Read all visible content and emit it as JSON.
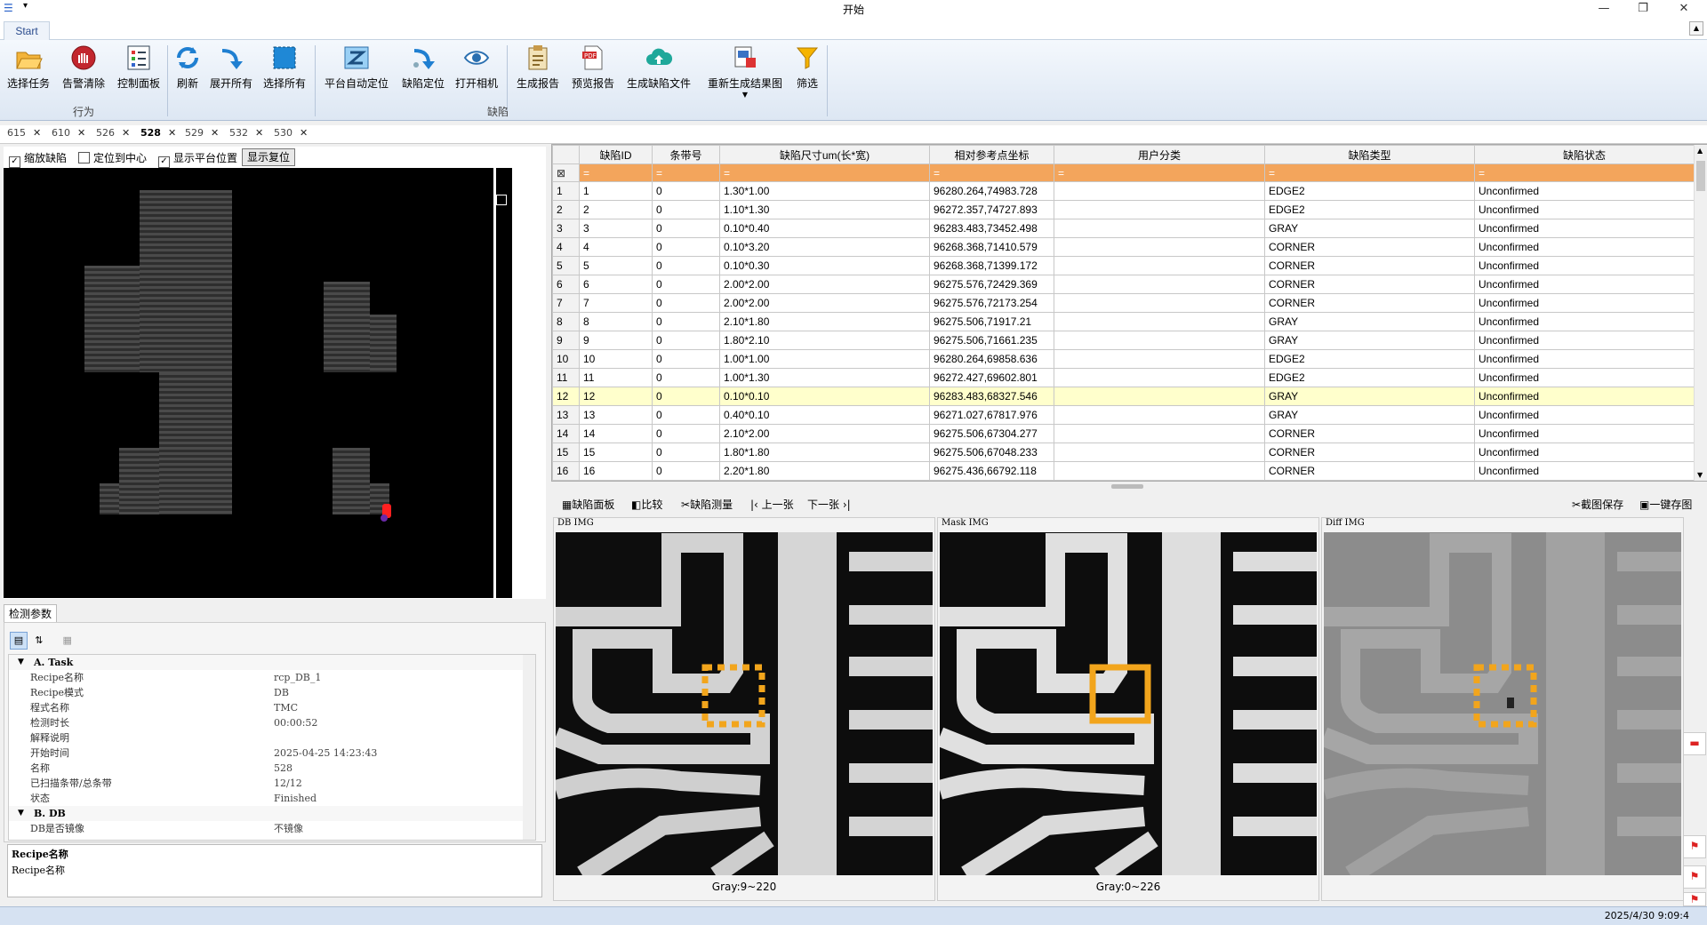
{
  "window": {
    "title": "开始",
    "tab": "Start"
  },
  "ribbon": {
    "buttons": [
      {
        "label": "选择任务",
        "icon": "folder-open-icon"
      },
      {
        "label": "告警清除",
        "icon": "alarm-clear-icon"
      },
      {
        "label": "控制面板",
        "icon": "control-panel-icon"
      },
      {
        "label": "刷新",
        "icon": "refresh-icon"
      },
      {
        "label": "展开所有",
        "icon": "expand-all-icon"
      },
      {
        "label": "选择所有",
        "icon": "select-all-icon"
      },
      {
        "label": "平台自动定位",
        "icon": "auto-locate-icon"
      },
      {
        "label": "缺陷定位",
        "icon": "defect-locate-icon"
      },
      {
        "label": "打开相机",
        "icon": "eye-icon"
      },
      {
        "label": "生成报告",
        "icon": "report-icon"
      },
      {
        "label": "预览报告",
        "icon": "pdf-icon"
      },
      {
        "label": "生成缺陷文件",
        "icon": "cloud-upload-icon"
      },
      {
        "label": "重新生成结果图",
        "icon": "regenerate-icon"
      },
      {
        "label": "筛选",
        "icon": "filter-icon"
      }
    ],
    "groups": {
      "behavior": "行为",
      "defect": "缺陷"
    }
  },
  "doc_tabs": [
    "615",
    "610",
    "526",
    "528",
    "529",
    "532",
    "530"
  ],
  "options": {
    "zoom_defect": "缩放缺陷",
    "center": "定位到中心",
    "show_platform": "显示平台位置",
    "reset": "显示复位"
  },
  "params": {
    "tab": "检测参数",
    "rows": [
      {
        "cat": true,
        "k": "A. Task",
        "v": ""
      },
      {
        "k": "Recipe名称",
        "v": "rcp_DB_1"
      },
      {
        "k": "Recipe模式",
        "v": "DB"
      },
      {
        "k": "程式名称",
        "v": "TMC"
      },
      {
        "k": "检测时长",
        "v": "00:00:52"
      },
      {
        "k": "解释说明",
        "v": ""
      },
      {
        "k": "开始时间",
        "v": "2025-04-25 14:23:43"
      },
      {
        "k": "名称",
        "v": "528"
      },
      {
        "k": "已扫描条带/总条带",
        "v": "12/12"
      },
      {
        "k": "状态",
        "v": "Finished"
      },
      {
        "cat": true,
        "k": "B. DB",
        "v": ""
      },
      {
        "k": "DB是否镜像",
        "v": "不镜像"
      }
    ],
    "desc_title": "Recipe名称",
    "desc_text": "Recipe名称"
  },
  "grid": {
    "columns": [
      "缺陷ID",
      "条带号",
      "缺陷尺寸um(长*宽)",
      "相对参考点坐标",
      "用户分类",
      "缺陷类型",
      "缺陷状态"
    ],
    "rows": [
      [
        "1",
        "1",
        "0",
        "1.30*1.00",
        "96280.264,74983.728",
        "",
        "EDGE2",
        "Unconfirmed"
      ],
      [
        "2",
        "2",
        "0",
        "1.10*1.30",
        "96272.357,74727.893",
        "",
        "EDGE2",
        "Unconfirmed"
      ],
      [
        "3",
        "3",
        "0",
        "0.10*0.40",
        "96283.483,73452.498",
        "",
        "GRAY",
        "Unconfirmed"
      ],
      [
        "4",
        "4",
        "0",
        "0.10*3.20",
        "96268.368,71410.579",
        "",
        "CORNER",
        "Unconfirmed"
      ],
      [
        "5",
        "5",
        "0",
        "0.10*0.30",
        "96268.368,71399.172",
        "",
        "CORNER",
        "Unconfirmed"
      ],
      [
        "6",
        "6",
        "0",
        "2.00*2.00",
        "96275.576,72429.369",
        "",
        "CORNER",
        "Unconfirmed"
      ],
      [
        "7",
        "7",
        "0",
        "2.00*2.00",
        "96275.576,72173.254",
        "",
        "CORNER",
        "Unconfirmed"
      ],
      [
        "8",
        "8",
        "0",
        "2.10*1.80",
        "96275.506,71917.21",
        "",
        "GRAY",
        "Unconfirmed"
      ],
      [
        "9",
        "9",
        "0",
        "1.80*2.10",
        "96275.506,71661.235",
        "",
        "GRAY",
        "Unconfirmed"
      ],
      [
        "10",
        "10",
        "0",
        "1.00*1.00",
        "96280.264,69858.636",
        "",
        "EDGE2",
        "Unconfirmed"
      ],
      [
        "11",
        "11",
        "0",
        "1.00*1.30",
        "96272.427,69602.801",
        "",
        "EDGE2",
        "Unconfirmed"
      ],
      [
        "12",
        "12",
        "0",
        "0.10*0.10",
        "96283.483,68327.546",
        "",
        "GRAY",
        "Unconfirmed"
      ],
      [
        "13",
        "13",
        "0",
        "0.40*0.10",
        "96271.027,67817.976",
        "",
        "GRAY",
        "Unconfirmed"
      ],
      [
        "14",
        "14",
        "0",
        "2.10*2.00",
        "96275.506,67304.277",
        "",
        "CORNER",
        "Unconfirmed"
      ],
      [
        "15",
        "15",
        "0",
        "1.80*1.80",
        "96275.506,67048.233",
        "",
        "CORNER",
        "Unconfirmed"
      ],
      [
        "16",
        "16",
        "0",
        "2.20*1.80",
        "96275.436,66792.118",
        "",
        "CORNER",
        "Unconfirmed"
      ]
    ],
    "selected_row": 12
  },
  "imgtool": {
    "defect_panel": "缺陷面板",
    "compare": "比较",
    "measure": "缺陷测量",
    "prev": "上一张",
    "next": "下一张",
    "save_shot": "截图保存",
    "save_all": "一键存图"
  },
  "images": {
    "db": {
      "caption": "DB IMG",
      "gray": "Gray:9~220"
    },
    "mask": {
      "caption": "Mask IMG",
      "gray": "Gray:0~226"
    },
    "diff": {
      "caption": "Diff IMG",
      "gray": ""
    }
  },
  "status": {
    "time": "2025/4/30 9:09:4"
  },
  "colors": {
    "accent": "#f3a55c",
    "selected": "#ffffcc",
    "box": "#f2a51c"
  }
}
